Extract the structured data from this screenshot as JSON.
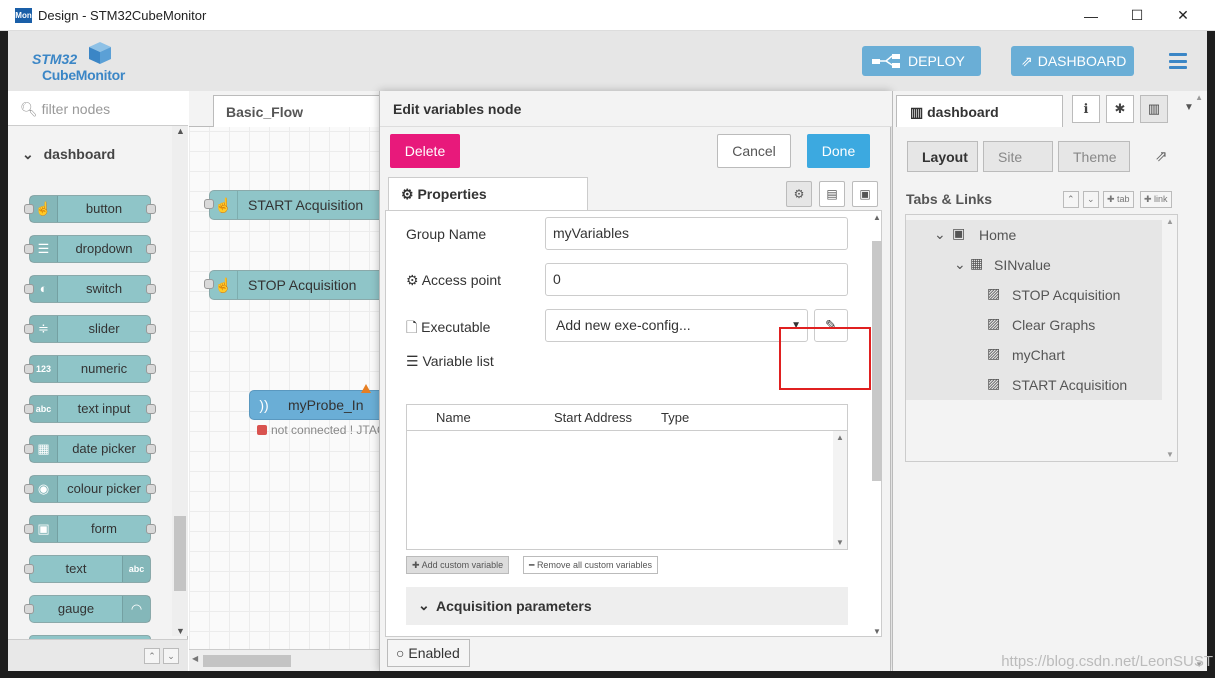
{
  "window": {
    "icon_text": "Mon",
    "title": "Design - STM32CubeMonitor",
    "controls": [
      "—",
      "☐",
      "✕"
    ]
  },
  "header": {
    "logo_line1": "STM32",
    "logo_line2": "CubeMonitor",
    "deploy_label": "DEPLOY",
    "dashboard_label": "DASHBOARD"
  },
  "palette": {
    "filter_placeholder": "filter nodes",
    "category": "dashboard",
    "nodes": [
      {
        "label": "button",
        "icon": "hand-pointer-icon"
      },
      {
        "label": "dropdown",
        "icon": "list-icon"
      },
      {
        "label": "switch",
        "icon": "toggle-icon"
      },
      {
        "label": "slider",
        "icon": "sliders-icon"
      },
      {
        "label": "numeric",
        "icon": "123-icon",
        "icon_text": "123"
      },
      {
        "label": "text input",
        "icon": "abc-icon",
        "icon_text": "abc"
      },
      {
        "label": "date picker",
        "icon": "calendar-icon"
      },
      {
        "label": "colour picker",
        "icon": "palette-icon"
      },
      {
        "label": "form",
        "icon": "form-icon"
      },
      {
        "label": "text",
        "icon": "abc-icon",
        "icon_text": "abc"
      },
      {
        "label": "gauge",
        "icon": "gauge-icon"
      }
    ]
  },
  "workspace": {
    "tab": "Basic_Flow",
    "nodes": [
      {
        "label": "START Acquisition"
      },
      {
        "label": "STOP Acquisition"
      },
      {
        "label": "myProbe_In"
      }
    ],
    "status_text": "not connected ! JTAG"
  },
  "tray": {
    "title": "Edit variables node",
    "delete_label": "Delete",
    "cancel_label": "Cancel",
    "done_label": "Done",
    "properties_tab": "Properties",
    "group_name_label": "Group Name",
    "group_name_value": "myVariables",
    "access_point_label": "Access point",
    "access_point_value": "0",
    "executable_label": "Executable",
    "executable_value": "Add new exe-config...",
    "variable_list_label": "Variable list",
    "columns": [
      "Name",
      "Start Address",
      "Type"
    ],
    "add_custom_label": "Add custom variable",
    "remove_all_label": "Remove all custom variables",
    "acquisition_label": "Acquisition parameters",
    "enabled_label": "Enabled"
  },
  "sidebar": {
    "tab": "dashboard",
    "subtabs": [
      "Layout",
      "Site",
      "Theme"
    ],
    "tabs_links_label": "Tabs & Links",
    "tab_btn": "tab",
    "link_btn": "link",
    "tree": [
      {
        "label": "Home",
        "level": 0
      },
      {
        "label": "SINvalue",
        "level": 1
      },
      {
        "label": "STOP Acquisition",
        "level": 2
      },
      {
        "label": "Clear Graphs",
        "level": 2
      },
      {
        "label": "myChart",
        "level": 2
      },
      {
        "label": "START Acquisition",
        "level": 2
      }
    ]
  },
  "watermark": "https://blog.csdn.net/LeonSUST",
  "colors": {
    "node": "#8fc5c8",
    "header_button": "#6aaed6",
    "delete": "#e8197b",
    "done": "#3ca9e0",
    "highlight": "#e02020"
  }
}
